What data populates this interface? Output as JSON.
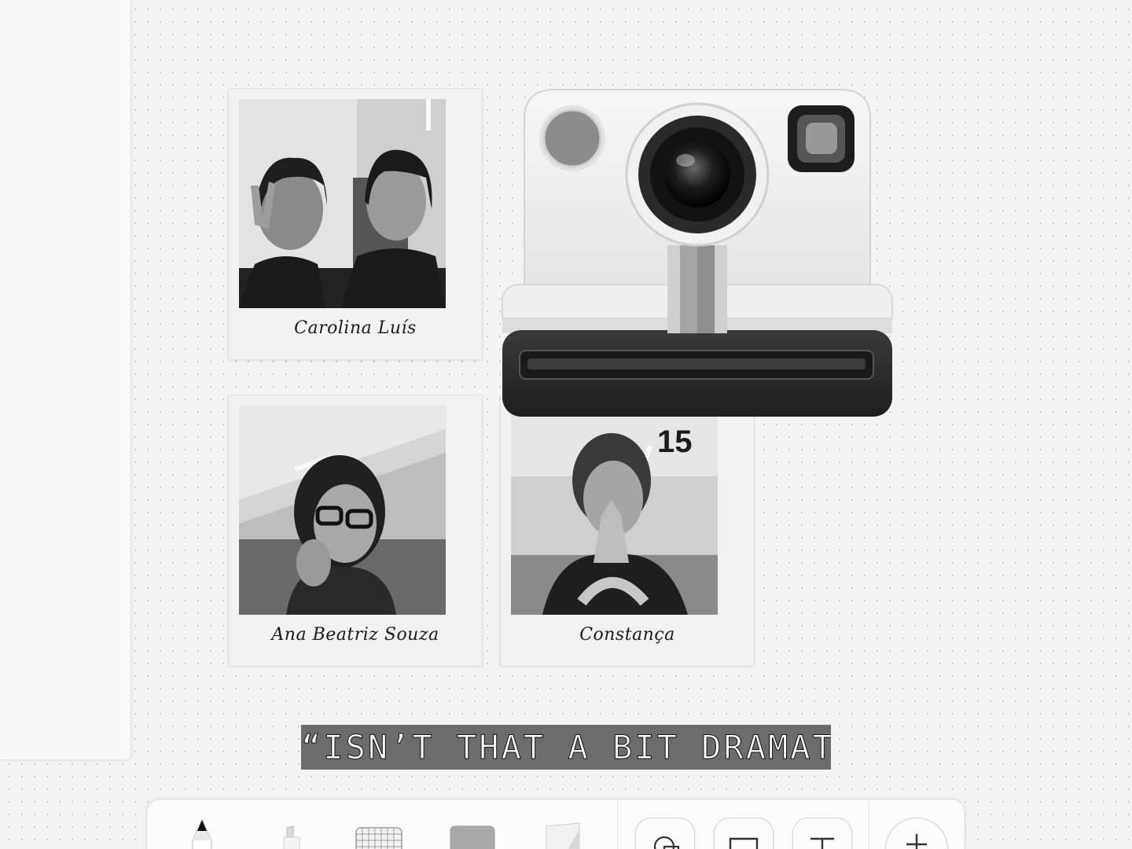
{
  "polaroids": [
    {
      "caption": "Carolina Luís"
    },
    {
      "caption": "Ana Beatriz Souza"
    },
    {
      "caption": "Constança"
    }
  ],
  "camera": {
    "photo_counter": "15"
  },
  "quote": "“ISN’T THAT A BIT DRAMATIC?”",
  "toolbar": {
    "tools": [
      {
        "icon": "pen-icon"
      },
      {
        "icon": "marker-icon"
      },
      {
        "icon": "grid-paper-icon"
      },
      {
        "icon": "sticky-note-icon"
      },
      {
        "icon": "ruler-icon"
      }
    ],
    "actions": [
      {
        "icon": "shapes-icon"
      },
      {
        "icon": "frame-icon"
      },
      {
        "icon": "text-icon"
      },
      {
        "icon": "plus-icon"
      }
    ]
  },
  "colors": {
    "canvas_bg": "#f4f4f4",
    "quote_bg": "#6c6c6c",
    "camera_body": "#ececec",
    "camera_bottom": "#2e2e2e"
  }
}
